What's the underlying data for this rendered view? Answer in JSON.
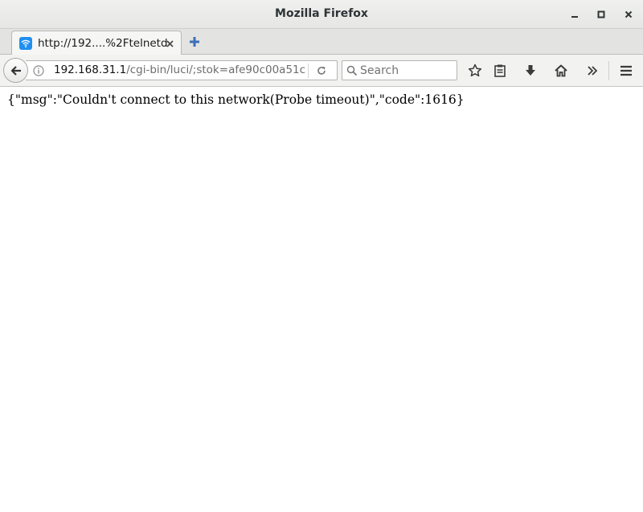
{
  "window": {
    "title": "Mozilla Firefox"
  },
  "tabs": [
    {
      "label": "http://192....%2Ftelnetd",
      "favicon": "wifi-icon",
      "active": true
    }
  ],
  "navbar": {
    "url_host": "192.168.31.1",
    "url_path": "/cgi-bin/luci/;stok=afe90c00a51c",
    "search_placeholder": "Search"
  },
  "content": {
    "body_text": "{\"msg\":\"Couldn't connect to this network(Probe timeout)\",\"code\":1616}"
  },
  "colors": {
    "favicon_blue": "#1f8ff0",
    "titlebar": "#e6e6e4",
    "navbar": "#f2f2f1"
  }
}
